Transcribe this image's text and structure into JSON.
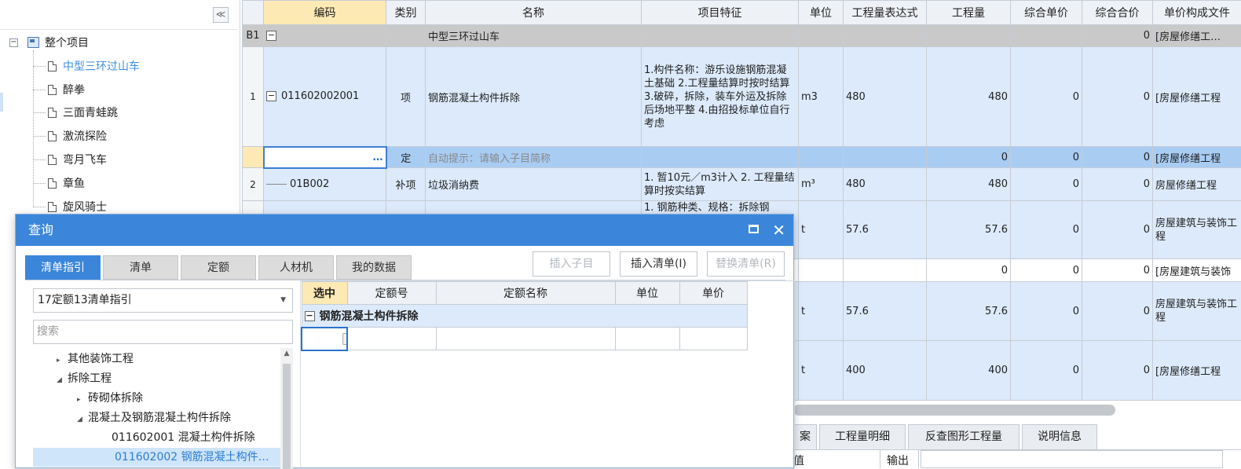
{
  "left_tree": {
    "collapse_label": "≪",
    "root_label": "整个项目",
    "items": [
      "中型三环过山车",
      "醉拳",
      "三面青蛙跳",
      "激流探险",
      "弯月飞车",
      "章鱼",
      "旋风骑士"
    ]
  },
  "grid": {
    "headers": [
      "",
      "编码",
      "类别",
      "名称",
      "项目特征",
      "单位",
      "工程量表达式",
      "工程量",
      "综合单价",
      "综合合价",
      "单价构成文件"
    ],
    "b1": {
      "rn": "B1",
      "name": "中型三环过山车",
      "total": "0",
      "file": "[房屋修缮工…"
    },
    "rows": [
      {
        "rn": "1",
        "code": "011602002001",
        "type": "项",
        "name": "钢筋混凝土构件拆除",
        "feat": "1.构件名称：游乐设施钢筋混凝土基础\n2.工程量结算时按时结算\n3.破碎，拆除，装车外运及拆除后场地平整\n4.由招投标单位自行考虑",
        "unit": "m3",
        "expr": "480",
        "qty": "480",
        "price": "0",
        "total": "0",
        "file": "[房屋修缮工程"
      },
      {
        "rn": "",
        "code": "…",
        "type": "定",
        "name": "自动提示：请输入子目简称",
        "feat": "",
        "unit": "",
        "expr": "",
        "qty": "0",
        "price": "0",
        "total": "0",
        "file": "[房屋修缮工程"
      },
      {
        "rn": "2",
        "code": "01B002",
        "type": "补项",
        "name": "垃圾消纳费",
        "feat": "1. 暂10元／m3计入\n2. 工程量结算时按实结算",
        "unit": "m³",
        "expr": "480",
        "qty": "480",
        "price": "0",
        "total": "0",
        "file": "房屋修缮工程"
      },
      {
        "rn": "",
        "code": "",
        "type": "",
        "name": "",
        "feat": "1. 钢筋种类、规格：拆除钢",
        "unit": "t",
        "expr": "57.6",
        "qty": "57.6",
        "price": "0",
        "total": "0",
        "file": "房屋建筑与装饰工程"
      },
      {
        "rn": "",
        "code": "",
        "type": "",
        "name": "",
        "feat": "",
        "unit": "",
        "expr": "",
        "qty": "0",
        "price": "0",
        "total": "0",
        "file": "[房屋建筑与装饰"
      },
      {
        "rn": "",
        "code": "",
        "type": "",
        "name": "",
        "feat": "",
        "unit": "t",
        "expr": "57.6",
        "qty": "57.6",
        "price": "0",
        "total": "0",
        "file": "房屋建筑与装饰工程"
      },
      {
        "rn": "",
        "code": "",
        "type": "",
        "name": "",
        "feat": "",
        "unit": "t",
        "expr": "400",
        "qty": "400",
        "price": "0",
        "total": "0",
        "file": "[房屋修缮工程"
      }
    ]
  },
  "bottom_tabs": [
    "案",
    "工程量明细",
    "反查图形工程量",
    "说明信息"
  ],
  "bottom_row": {
    "left": "值",
    "mid": "输出"
  },
  "dialog": {
    "title": "查询",
    "tabs": [
      "清单指引",
      "清单",
      "定额",
      "人材机",
      "我的数据"
    ],
    "btn_insert_child": "插入子目",
    "btn_insert_list": "插入清单(I)",
    "btn_replace": "替换清单(R)",
    "combo_value": "17定额13清单指引",
    "search_placeholder": "搜索",
    "tree": [
      {
        "label": "其他装饰工程",
        "indent": 1,
        "tri": "▸"
      },
      {
        "label": "拆除工程",
        "indent": 1,
        "tri": "◢"
      },
      {
        "label": "砖砌体拆除",
        "indent": 2,
        "tri": "▸"
      },
      {
        "label": "混凝土及钢筋混凝土构件拆除",
        "indent": 2,
        "tri": "◢"
      },
      {
        "label": "011602001  混凝土构件拆除",
        "indent": 3,
        "tri": ""
      },
      {
        "label": "011602002  钢筋混凝土构件…",
        "indent": 3,
        "tri": ""
      }
    ],
    "right_headers": [
      "选中",
      "定额号",
      "定额名称",
      "单位",
      "单价"
    ],
    "group_label": "钢筋混凝土构件拆除"
  }
}
